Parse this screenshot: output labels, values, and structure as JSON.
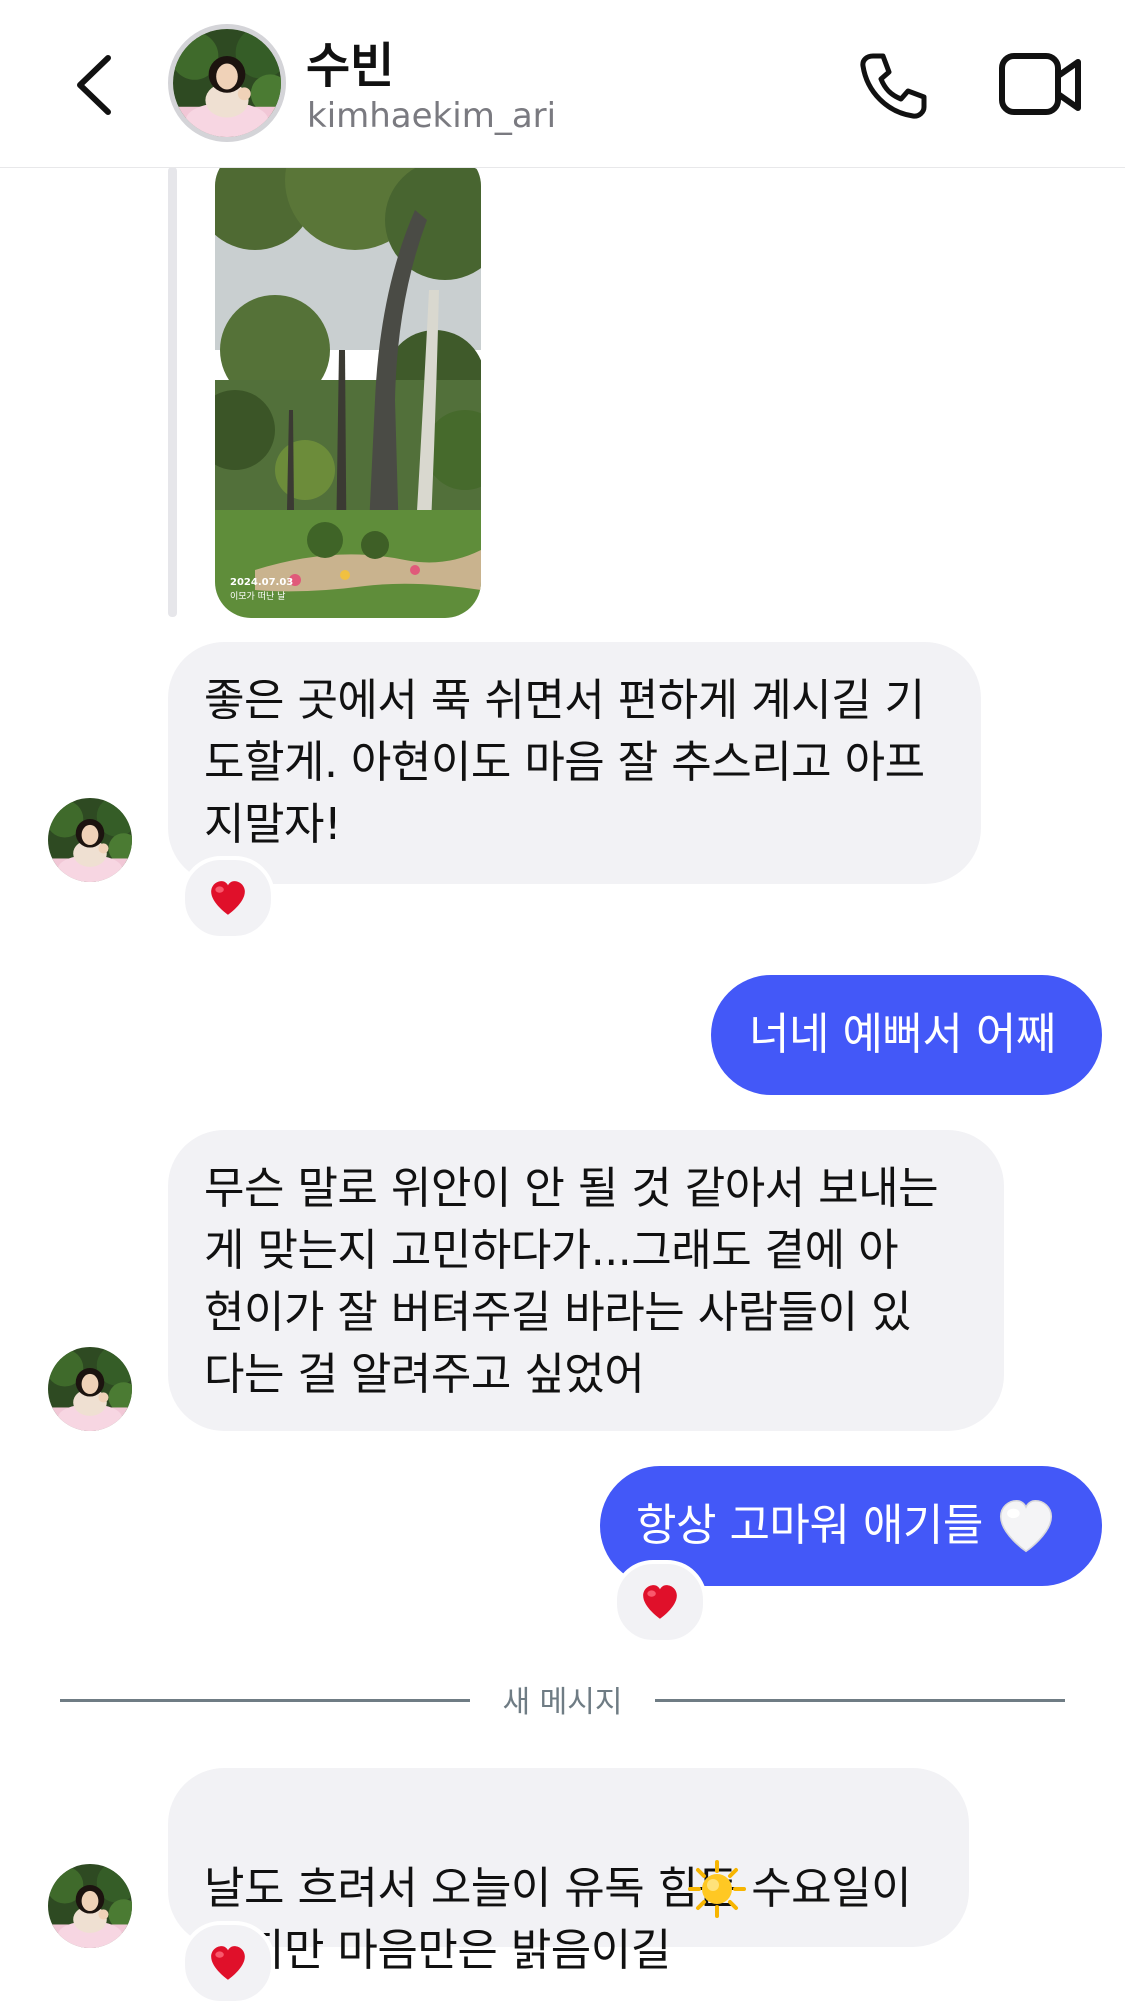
{
  "header": {
    "name": "수빈",
    "username": "kimhaekim_ari"
  },
  "shared_photo": {
    "date": "2024.07.03",
    "caption": "이모가 떠난 날"
  },
  "messages": [
    {
      "from": "them",
      "text": "좋은 곳에서 푹 쉬면서 편하게 계시길 기\n도할게. 아현이도 마음 잘 추스리고 아프\n지말자!",
      "reaction": "heart"
    },
    {
      "from": "me",
      "text": "너네 예뻐서 어째"
    },
    {
      "from": "them",
      "text": "무슨 말로 위안이 안 될 것 같아서 보내는\n게 맞는지 고민하다가...그래도 곁에 아\n현이가 잘 버텨주길 바라는 사람들이 있\n다는 걸 알려주고 싶었어"
    },
    {
      "from": "me",
      "text": "항상 고마워 애기들",
      "emoji": "white-heart",
      "reaction": "heart"
    },
    {
      "from": "them",
      "text": "날도 흐려서 오늘이 유독 힘든 수요일이\n겠지만 마음만은 밝음이길",
      "emoji": "sun",
      "reaction": "heart"
    }
  ],
  "divider": {
    "label": "새 메시지"
  },
  "colors": {
    "accent_bubble": "#4358f8",
    "incoming_bubble": "#f2f2f5",
    "reaction_heart": "#e0102a",
    "divider": "#6f7c84"
  },
  "icons": [
    "chevron-left-icon",
    "phone-icon",
    "video-camera-icon",
    "heart-icon",
    "white-heart-icon",
    "sun-icon"
  ]
}
